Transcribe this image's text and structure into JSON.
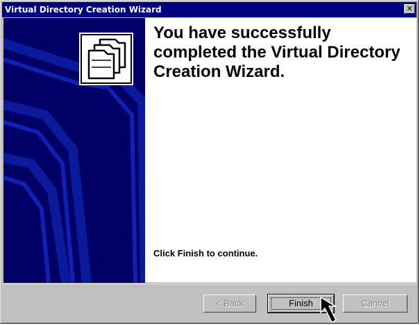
{
  "window": {
    "title": "Virtual Directory Creation Wizard",
    "close_glyph": "✕"
  },
  "banner": {
    "background": "#000066",
    "icon": "folders-icon"
  },
  "content": {
    "heading": "You have successfully completed the Virtual Directory Creation Wizard.",
    "hint": "Click Finish to continue."
  },
  "buttons": {
    "back": {
      "label": "< Back",
      "enabled": false
    },
    "finish": {
      "label": "Finish",
      "enabled": true,
      "focused": true
    },
    "cancel": {
      "label": "Cancel",
      "enabled": false
    }
  },
  "colors": {
    "titlebar": "#00007f",
    "dialog": "#c0c0c0",
    "banner": "#000066"
  }
}
